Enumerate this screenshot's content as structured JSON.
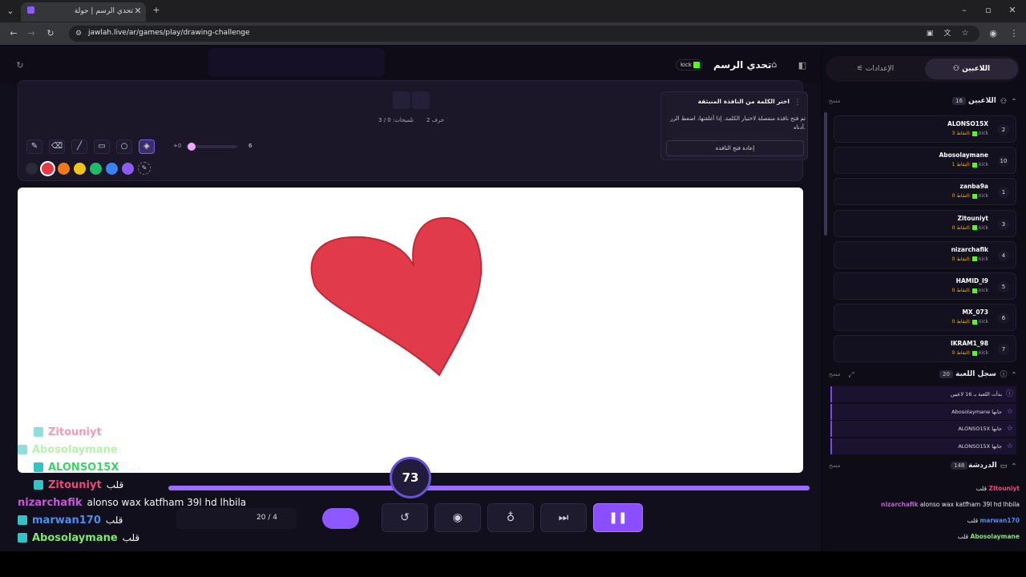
{
  "browser": {
    "tab_title": "تحدي الرسم | جولة",
    "url": "jawlah.live/ar/games/play/drawing-challenge"
  },
  "header": {
    "title": "تحدي الرسم",
    "kick_label": "kick"
  },
  "word_panel": {
    "letters": "2 حرف",
    "hints": "تلميحات: 0 / 3"
  },
  "tools": {
    "brush_size": "6",
    "size_min_label": "+0"
  },
  "colors": [
    "#2a2a38",
    "#e53945",
    "#f07a1a",
    "#f0c419",
    "#1dbb6a",
    "#3b82f6",
    "#8b5cf6"
  ],
  "popup": {
    "title": "اختر الكلمة من النافذة المنبثقة",
    "body": "تم فتح نافذة منفصلة لاختيار الكلمة. إذا أغلقتها، اضغط الزر أدناه.",
    "button": "إعادة فتح النافذة"
  },
  "overlay_chat": [
    {
      "name": "Zitouniyt",
      "msg": "",
      "color": "#e84a7a",
      "faded": true
    },
    {
      "name": "Abosolaymane",
      "msg": "",
      "color": "#7ee86b",
      "faded": true
    },
    {
      "name": "ALONSO15X",
      "msg": "قلب",
      "color": "#3fd16a",
      "faded": false
    },
    {
      "name": "Zitouniyt",
      "msg": "قلب",
      "color": "#e84a7a",
      "faded": false
    },
    {
      "name": "nizarchafik",
      "msg": "alonso wax katfham 39l hd lhbila",
      "color": "#c658d8",
      "faded": false
    },
    {
      "name": "marwan170",
      "msg": "قلب",
      "color": "#4a8ef0",
      "faded": false
    },
    {
      "name": "Abosolaymane",
      "msg": "قلب",
      "color": "#7ee86b",
      "faded": false
    }
  ],
  "controls": {
    "timer": "73",
    "round": "20 / 4"
  },
  "sidebar": {
    "tab_players": "اللاعبين",
    "tab_settings": "الإعدادات",
    "players_header": "اللاعبين",
    "players_count": "16",
    "clear": "مسح",
    "points_label": "النقاط:",
    "players": [
      {
        "name": "ALONSO15X",
        "points": "3",
        "rank": "2"
      },
      {
        "name": "Abosolaymane",
        "points": "1",
        "rank": "10"
      },
      {
        "name": "zanba9a",
        "points": "0",
        "rank": "1"
      },
      {
        "name": "Zitouniyt",
        "points": "0",
        "rank": "3"
      },
      {
        "name": "nizarchafik",
        "points": "0",
        "rank": "4"
      },
      {
        "name": "HAMID_I9",
        "points": "0",
        "rank": "5"
      },
      {
        "name": "MX_073",
        "points": "0",
        "rank": "6"
      },
      {
        "name": "IKRAM1_98",
        "points": "0",
        "rank": "7"
      }
    ],
    "log_header": "سجل اللعبة",
    "log_count": "20",
    "log": [
      "بدأت اللعبة بـ 16 لاعبين",
      "Abosolaymane جابها",
      "ALONSO15X جابها",
      "ALONSO15X جابها"
    ],
    "chat_header": "الدردشة",
    "chat_count": "148",
    "chat": [
      {
        "name": "Zitouniyt",
        "msg": "قلب",
        "color": "#e84a7a"
      },
      {
        "name": "nizarchafik",
        "msg": "alonso wax katfham 39l hd lhbila",
        "color": "#c658d8"
      },
      {
        "name": "marwan170",
        "msg": "قلب",
        "color": "#4a8ef0"
      },
      {
        "name": "Abosolaymane",
        "msg": "قلب",
        "color": "#7ee86b"
      }
    ]
  }
}
